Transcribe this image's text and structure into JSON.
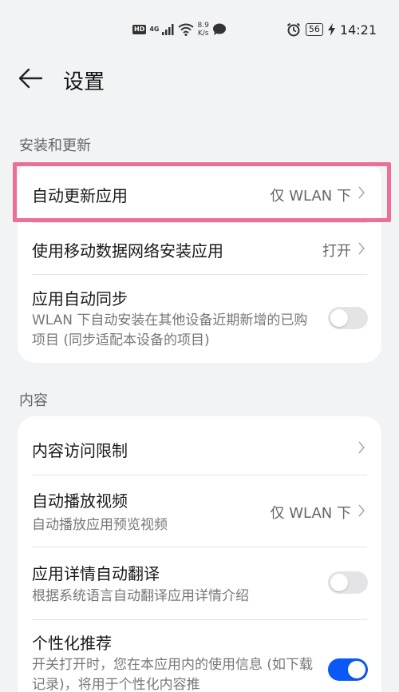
{
  "status_bar": {
    "hd": "HD",
    "network": "4G",
    "speed_value": "8.9",
    "speed_unit": "K/s",
    "battery": "56",
    "time": "14:21"
  },
  "header": {
    "title": "设置"
  },
  "sections": [
    {
      "label": "安装和更新",
      "rows": [
        {
          "title": "自动更新应用",
          "value": "仅 WLAN 下"
        },
        {
          "title": "使用移动数据网络安装应用",
          "value": "打开"
        },
        {
          "title": "应用自动同步",
          "subtitle": "WLAN 下自动安装在其他设备近期新增的已购项目 (同步适配本设备的项目)",
          "toggle_on": false
        }
      ]
    },
    {
      "label": "内容",
      "rows": [
        {
          "title": "内容访问限制"
        },
        {
          "title": "自动播放视频",
          "subtitle": "自动播放应用预览视频",
          "value": "仅 WLAN 下"
        },
        {
          "title": "应用详情自动翻译",
          "subtitle": "根据系统语言自动翻译应用详情介绍",
          "toggle_on": false
        },
        {
          "title": "个性化推荐",
          "subtitle": "开关打开时，您在本应用内的使用信息 (如下载记录)，将用于个性化内容推",
          "toggle_on": true
        }
      ]
    }
  ],
  "colors": {
    "accent": "#0a59f7",
    "highlight": "#ee6f96",
    "background": "#f1f3f5"
  }
}
